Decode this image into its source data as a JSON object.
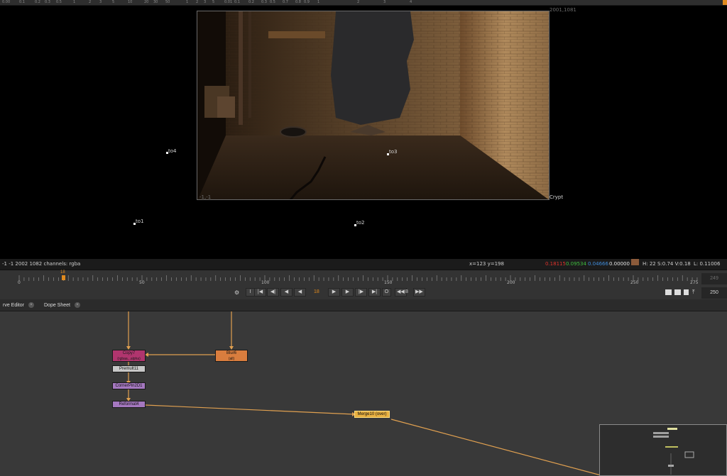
{
  "top_ruler": {
    "ticks": [
      "0.00",
      "0.1",
      "0.2",
      "0.3",
      "0.5",
      "1",
      "2",
      "3",
      "5",
      "10",
      "20",
      "30",
      "50",
      "1",
      "2",
      "3",
      "5",
      "0.01",
      "0.1",
      "0.2",
      "0.3",
      "0.5",
      "0.7",
      "0.8",
      "0.9",
      "1",
      "2",
      "3",
      "4"
    ]
  },
  "viewer": {
    "bbox_top_right": "2001,1081",
    "bbox_bottom_left": "-1,-1",
    "layer_label": "Crypt",
    "points": {
      "to1": "to1",
      "to2": "to2",
      "to3": "to3",
      "to4": "to4"
    }
  },
  "infobar": {
    "format": "-1 -1 2002 1082  channels: rgba",
    "coords": "x=123 y=198",
    "r": "0.18115",
    "g": "0.09534",
    "b": "0.04666",
    "a": "0.00000",
    "hsv": "H: 22 S:0.74 V:0.18",
    "lum": "L: 0.11006",
    "colors": {
      "r": "#e0322b",
      "g": "#3fbf3f",
      "b": "#3f8bd9",
      "swatch": "#8b5a3a"
    }
  },
  "timeline": {
    "ruler_numbers": [
      "0",
      "50",
      "100",
      "150",
      "200",
      "250",
      "275"
    ],
    "current_frame_marker": "18",
    "current_frame": "18",
    "step": "8",
    "range_end": "249",
    "range_out": "250",
    "controls": [
      "I",
      "|◀",
      "◀|",
      "◀",
      "◀",
      "▶",
      "▶",
      "|▶",
      "▶|",
      "O",
      "◀◀",
      "▶▶"
    ]
  },
  "tabs": [
    {
      "label": "rve Editor"
    },
    {
      "label": "Dope Sheet"
    }
  ],
  "nodes": {
    "copy": {
      "label": "Copy7",
      "sub": "(rgbaa...alpha)"
    },
    "blur": {
      "label": "Blur6",
      "sub": "(all)"
    },
    "premult": {
      "label": "Premult11"
    },
    "cornerpin": {
      "label": "CornerPin2D1"
    },
    "reformat": {
      "label": "Reformat4"
    },
    "merge": {
      "label": "Merge10 (over)"
    }
  }
}
